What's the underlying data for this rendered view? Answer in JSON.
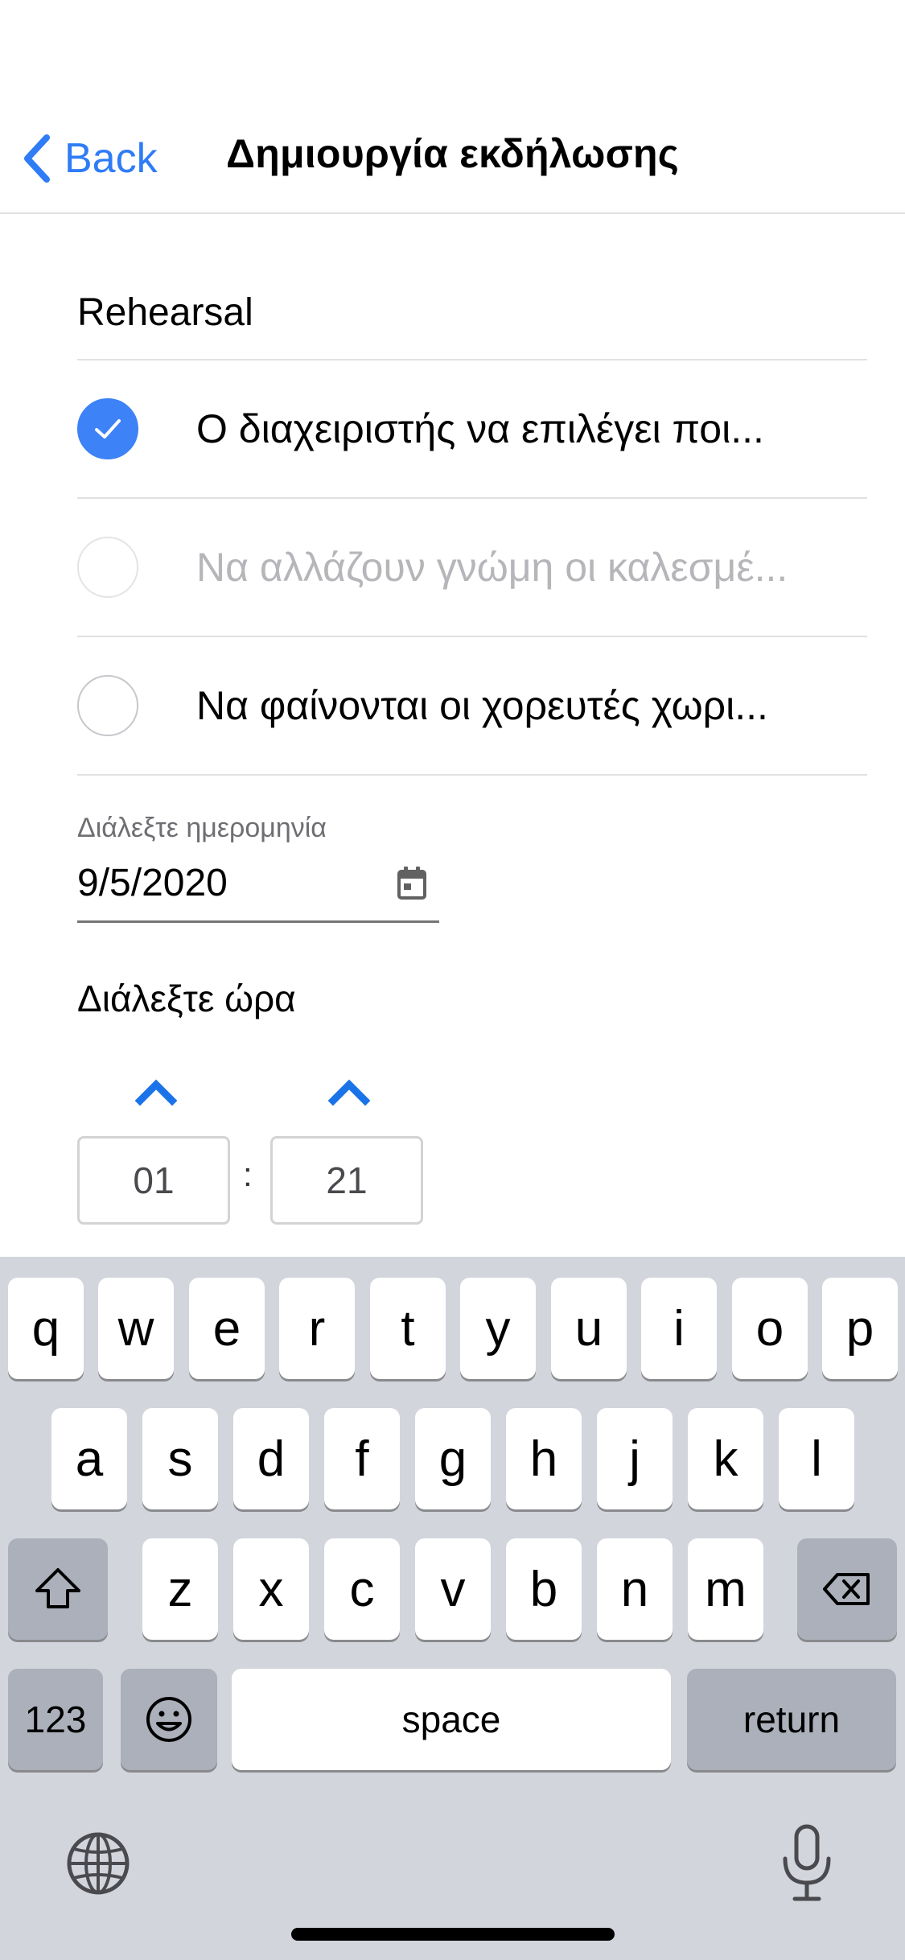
{
  "nav": {
    "back_label": "Back",
    "title": "Δημιουργία εκδήλωσης"
  },
  "form": {
    "title_value": "Rehearsal",
    "options": [
      {
        "label": "Ο διαχειριστής να επιλέγει ποι...",
        "checked": true,
        "disabled": false
      },
      {
        "label": "Να αλλάζουν γνώμη οι καλεσμέ...",
        "checked": false,
        "disabled": true
      },
      {
        "label": "Να φαίνονται οι χορευτές χωρι...",
        "checked": false,
        "disabled": false
      }
    ],
    "date_caption": "Διάλεξτε ημερομηνία",
    "date_value": "9/5/2020",
    "time_label": "Διάλεξτε ώρα",
    "hour": "01",
    "minute": "21",
    "time_separator": ":"
  },
  "keyboard": {
    "row1": [
      "q",
      "w",
      "e",
      "r",
      "t",
      "y",
      "u",
      "i",
      "o",
      "p"
    ],
    "row2": [
      "a",
      "s",
      "d",
      "f",
      "g",
      "h",
      "j",
      "k",
      "l"
    ],
    "row3": [
      "z",
      "x",
      "c",
      "v",
      "b",
      "n",
      "m"
    ],
    "numbers_key": "123",
    "space_key": "space",
    "return_key": "return"
  },
  "colors": {
    "accent": "#2f7cf6",
    "checkbox_checked": "#3d82f6",
    "keyboard_bg": "#d2d5db",
    "key_dark": "#abb0ba"
  }
}
